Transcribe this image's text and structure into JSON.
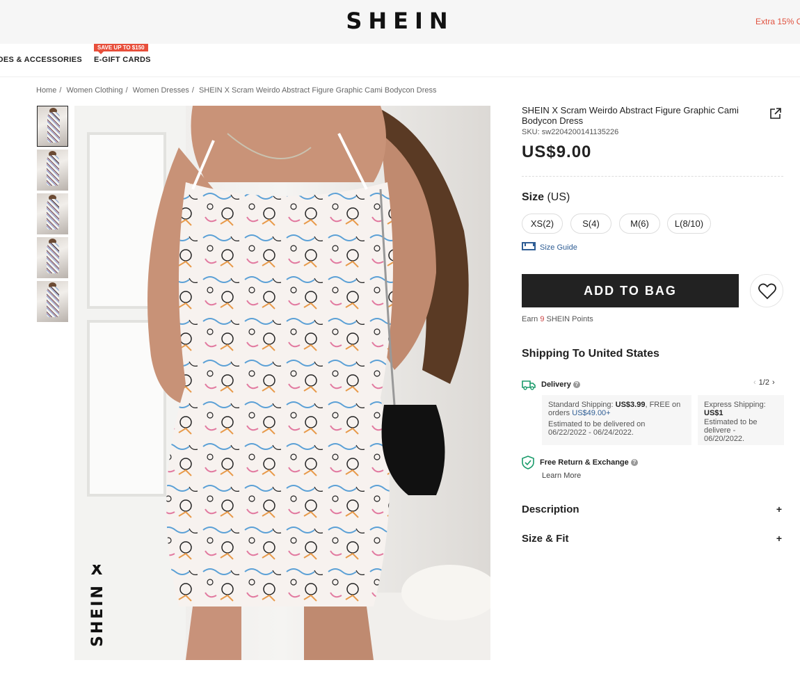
{
  "header": {
    "logo": "SHEIN",
    "promo": "Extra 15% O"
  },
  "nav": {
    "items": [
      "OES & ACCESSORIES",
      "E-GIFT CARDS"
    ],
    "badge": "SAVE UP TO $150"
  },
  "breadcrumb": {
    "items": [
      "Home",
      "/",
      "Women Clothing",
      "/",
      "Women Dresses",
      "/"
    ],
    "current": "SHEIN X Scram Weirdo Abstract Figure Graphic Cami Bodycon Dress"
  },
  "product": {
    "title": "SHEIN X Scram Weirdo Abstract Figure Graphic Cami Bodycon Dress",
    "sku_label": "SKU:",
    "sku": "sw2204200141135226",
    "price": "US$9.00",
    "size_label": "Size",
    "size_unit": "(US)",
    "sizes": [
      "XS(2)",
      "S(4)",
      "M(6)",
      "L(8/10)"
    ],
    "size_guide": "Size Guide",
    "add_to_bag": "ADD TO BAG",
    "points_pre": "Earn",
    "points_num": "9",
    "points_post": "SHEIN Points",
    "image_brand": "SHEIN X"
  },
  "shipping": {
    "title": "Shipping To United States",
    "pager": "1/2",
    "delivery_label": "Delivery",
    "standard": {
      "label": "Standard Shipping:",
      "price": "US$3.99",
      "free_text": ", FREE on orders",
      "threshold": "US$49.00+",
      "estimate": "Estimated to be delivered on 06/22/2022 - 06/24/2022."
    },
    "express": {
      "label": "Express Shipping:",
      "price": "US$1",
      "estimate": "Estimated to be delivere - 06/20/2022."
    },
    "return_label": "Free Return & Exchange",
    "learn_more": "Learn More"
  },
  "accordions": {
    "description": "Description",
    "size_fit": "Size & Fit",
    "plus": "+"
  },
  "colors": {
    "accent": "#e84f3b",
    "link": "#2e5d94",
    "button": "#222222",
    "icon_green": "#1a9b6b"
  }
}
